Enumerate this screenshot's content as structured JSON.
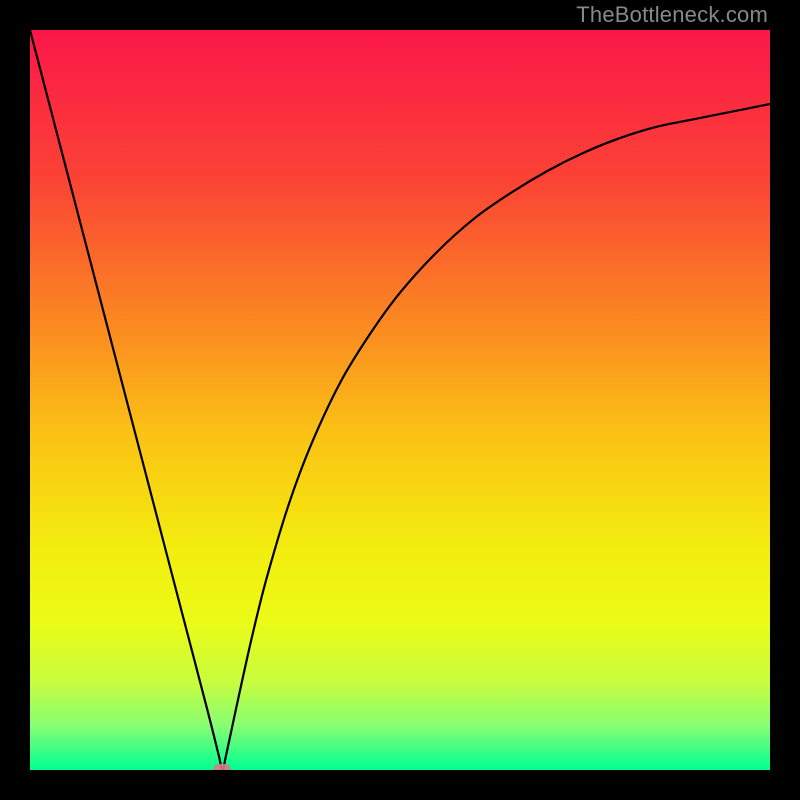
{
  "watermark": "TheBottleneck.com",
  "chart_data": {
    "type": "line",
    "title": "",
    "xlabel": "",
    "ylabel": "",
    "xlim": [
      0,
      100
    ],
    "ylim": [
      0,
      100
    ],
    "background": {
      "type": "vertical_gradient",
      "stops": [
        {
          "pos": 0.0,
          "color": "#fb1749"
        },
        {
          "pos": 0.2,
          "color": "#fb4235"
        },
        {
          "pos": 0.4,
          "color": "#fb8a21"
        },
        {
          "pos": 0.55,
          "color": "#fbc314"
        },
        {
          "pos": 0.7,
          "color": "#f3ed0f"
        },
        {
          "pos": 0.8,
          "color": "#ebfb17"
        },
        {
          "pos": 0.88,
          "color": "#c9fd3e"
        },
        {
          "pos": 0.94,
          "color": "#87fe72"
        },
        {
          "pos": 1.0,
          "color": "#00ff94"
        }
      ]
    },
    "series": [
      {
        "name": "bottleneck-curve",
        "color": "#000000",
        "x": [
          0,
          3,
          6,
          9,
          12,
          15,
          18,
          21,
          24,
          25.5,
          26,
          26.5,
          28,
          30,
          32,
          35,
          38,
          42,
          46,
          50,
          55,
          60,
          65,
          70,
          75,
          80,
          85,
          90,
          95,
          100
        ],
        "y": [
          100,
          88.5,
          77,
          65.5,
          54,
          42.5,
          31,
          19.5,
          8,
          2,
          0,
          2,
          9,
          18,
          26,
          36,
          44,
          52.5,
          59,
          64.5,
          70,
          74.5,
          78,
          81,
          83.5,
          85.5,
          87,
          88,
          89,
          90
        ]
      }
    ],
    "marker": {
      "x": 26,
      "y": 0,
      "color": "#d97a8a"
    }
  }
}
